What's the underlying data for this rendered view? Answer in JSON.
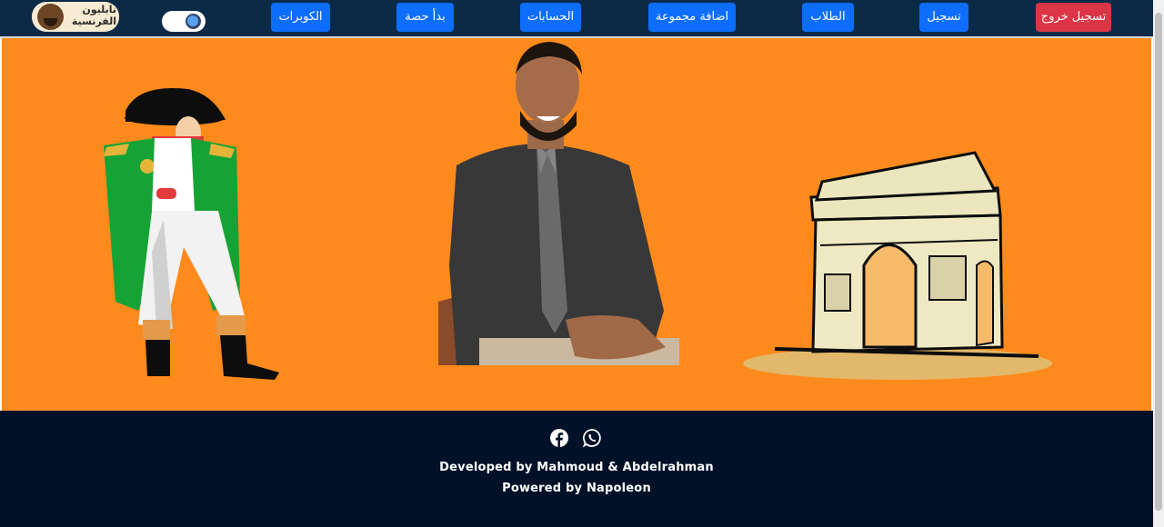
{
  "nav": {
    "logo_text_line1": "نابليون",
    "logo_text_line2": "الفرنسية",
    "buttons": {
      "logout": "تسجيل خروج",
      "register": "تسجيل",
      "students": "الطلاب",
      "add_group": "اضافة مجموعة",
      "accounts": "الحسابات",
      "start_session": "بدأ حصة",
      "coupons": "الكوبرات"
    }
  },
  "footer": {
    "developed_by": "Developed by Mahmoud & Abdelrahman",
    "powered_by": "Powered by Napoleon"
  },
  "icons": [
    "facebook-icon",
    "whatsapp-icon",
    "dark-mode-toggle"
  ],
  "colors": {
    "navbar": "#0b2a48",
    "hero": "#fd8a1c",
    "footer": "#001128",
    "primary_button": "#0d6efd",
    "danger_button": "#dc3545"
  }
}
